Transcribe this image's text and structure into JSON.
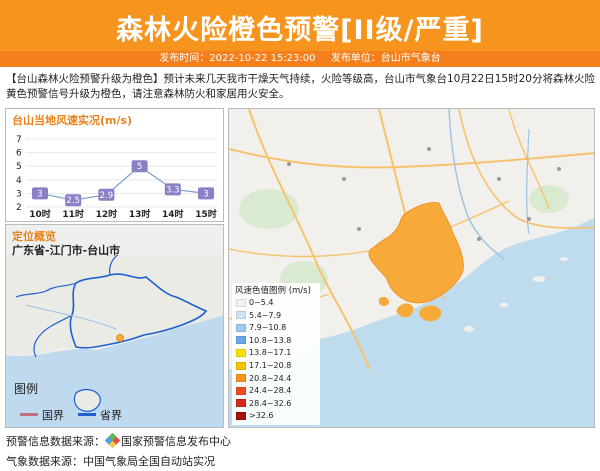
{
  "header": {
    "title": "森林火险橙色预警[II级/严重]",
    "publish_time_label": "发布时间：2022-10-22 15:23:00",
    "publisher_label": "发布单位：台山市气象台"
  },
  "description": "【台山森林火险预警升级为橙色】预计未来几天我市干燥天气持续，火险等级高，台山市气象台10月22日15时20分将森林火险黄色预警信号升级为橙色，请注意森林防火和家居用火安全。",
  "wind_panel": {
    "title": "台山当地风速实况(m/s)"
  },
  "chart_data": {
    "type": "line",
    "title": "台山当地风速实况(m/s)",
    "categories": [
      "10时",
      "11时",
      "12时",
      "13时",
      "14时",
      "15时"
    ],
    "values": [
      3,
      2.5,
      2.9,
      5,
      3.3,
      3
    ],
    "data_labels": [
      "3",
      "2.5",
      "2.9",
      "5",
      "3.3",
      "3"
    ],
    "ylim": [
      2,
      7
    ],
    "yticks": [
      "2",
      "3",
      "4",
      "5",
      "6",
      "7"
    ],
    "line_color": "#7ba3c8",
    "label_color": "#8a80c8",
    "grid": true
  },
  "location_panel": {
    "title": "定位概览",
    "subtitle": "广东省-江门市-台山市"
  },
  "small_map_legend": {
    "title": "图例",
    "items": [
      {
        "label": "国界",
        "color": "#c0707a"
      },
      {
        "label": "省界",
        "color": "#1f5fd1"
      }
    ]
  },
  "wind_scale": {
    "title": "风速色值图例 (m/s)",
    "items": [
      {
        "label": "0~5.4",
        "color": "#f2f2f2"
      },
      {
        "label": "5.4~7.9",
        "color": "#cfe3f7"
      },
      {
        "label": "7.9~10.8",
        "color": "#9fcaf0"
      },
      {
        "label": "10.8~13.8",
        "color": "#6aa8e8"
      },
      {
        "label": "13.8~17.1",
        "color": "#f5e000"
      },
      {
        "label": "17.1~20.8",
        "color": "#f8c400"
      },
      {
        "label": "20.8~24.4",
        "color": "#f7941d"
      },
      {
        "label": "24.4~28.4",
        "color": "#e8501d"
      },
      {
        "label": "28.4~32.6",
        "color": "#d42a1a"
      },
      {
        "label": ">32.6",
        "color": "#a8100c"
      }
    ]
  },
  "footer": {
    "warning_source": "预警信息数据来源：",
    "warning_source_name": "国家预警信息发布中心",
    "weather_source": "气象数据来源：中国气象局全国自动站实况"
  },
  "colors": {
    "header": "#f7941d",
    "meta_bar": "#f47f1c",
    "warning_area": "#f7a93a"
  }
}
